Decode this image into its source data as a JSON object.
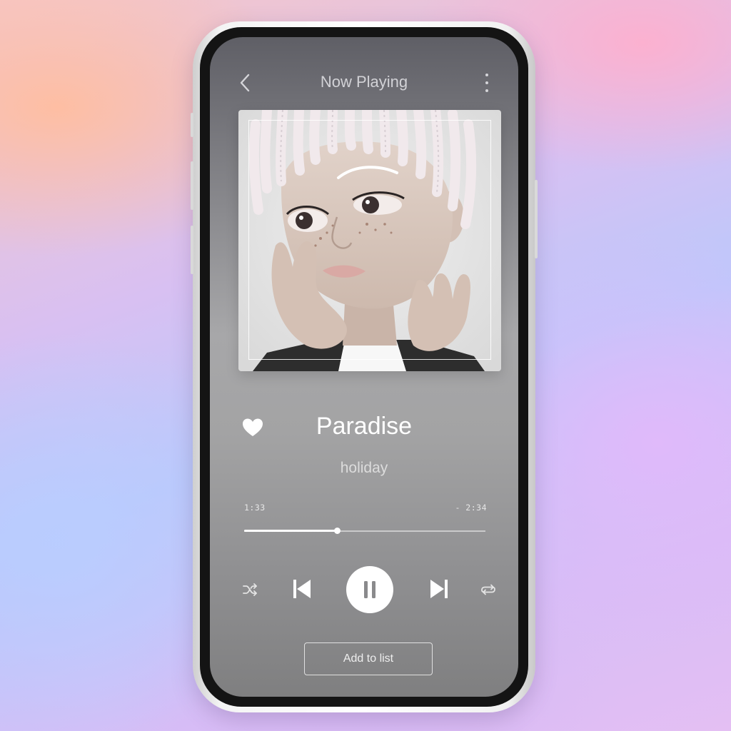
{
  "header": {
    "title": "Now Playing",
    "back_icon": "chevron-left-icon",
    "menu_icon": "more-vertical-icon"
  },
  "track": {
    "title": "Paradise",
    "artist": "holiday",
    "liked": true,
    "elapsed": "1:33",
    "remaining": "- 2:34",
    "progress_fraction": 0.385
  },
  "controls": {
    "shuffle_icon": "shuffle-icon",
    "previous_icon": "skip-previous-icon",
    "play_pause_icon": "pause-icon",
    "next_icon": "skip-next-icon",
    "repeat_icon": "repeat-icon"
  },
  "actions": {
    "add_to_list_label": "Add to list"
  },
  "colors": {
    "accent": "#ffffff",
    "screen_top": "#5f5f66",
    "screen_bottom": "#7f7f80"
  }
}
